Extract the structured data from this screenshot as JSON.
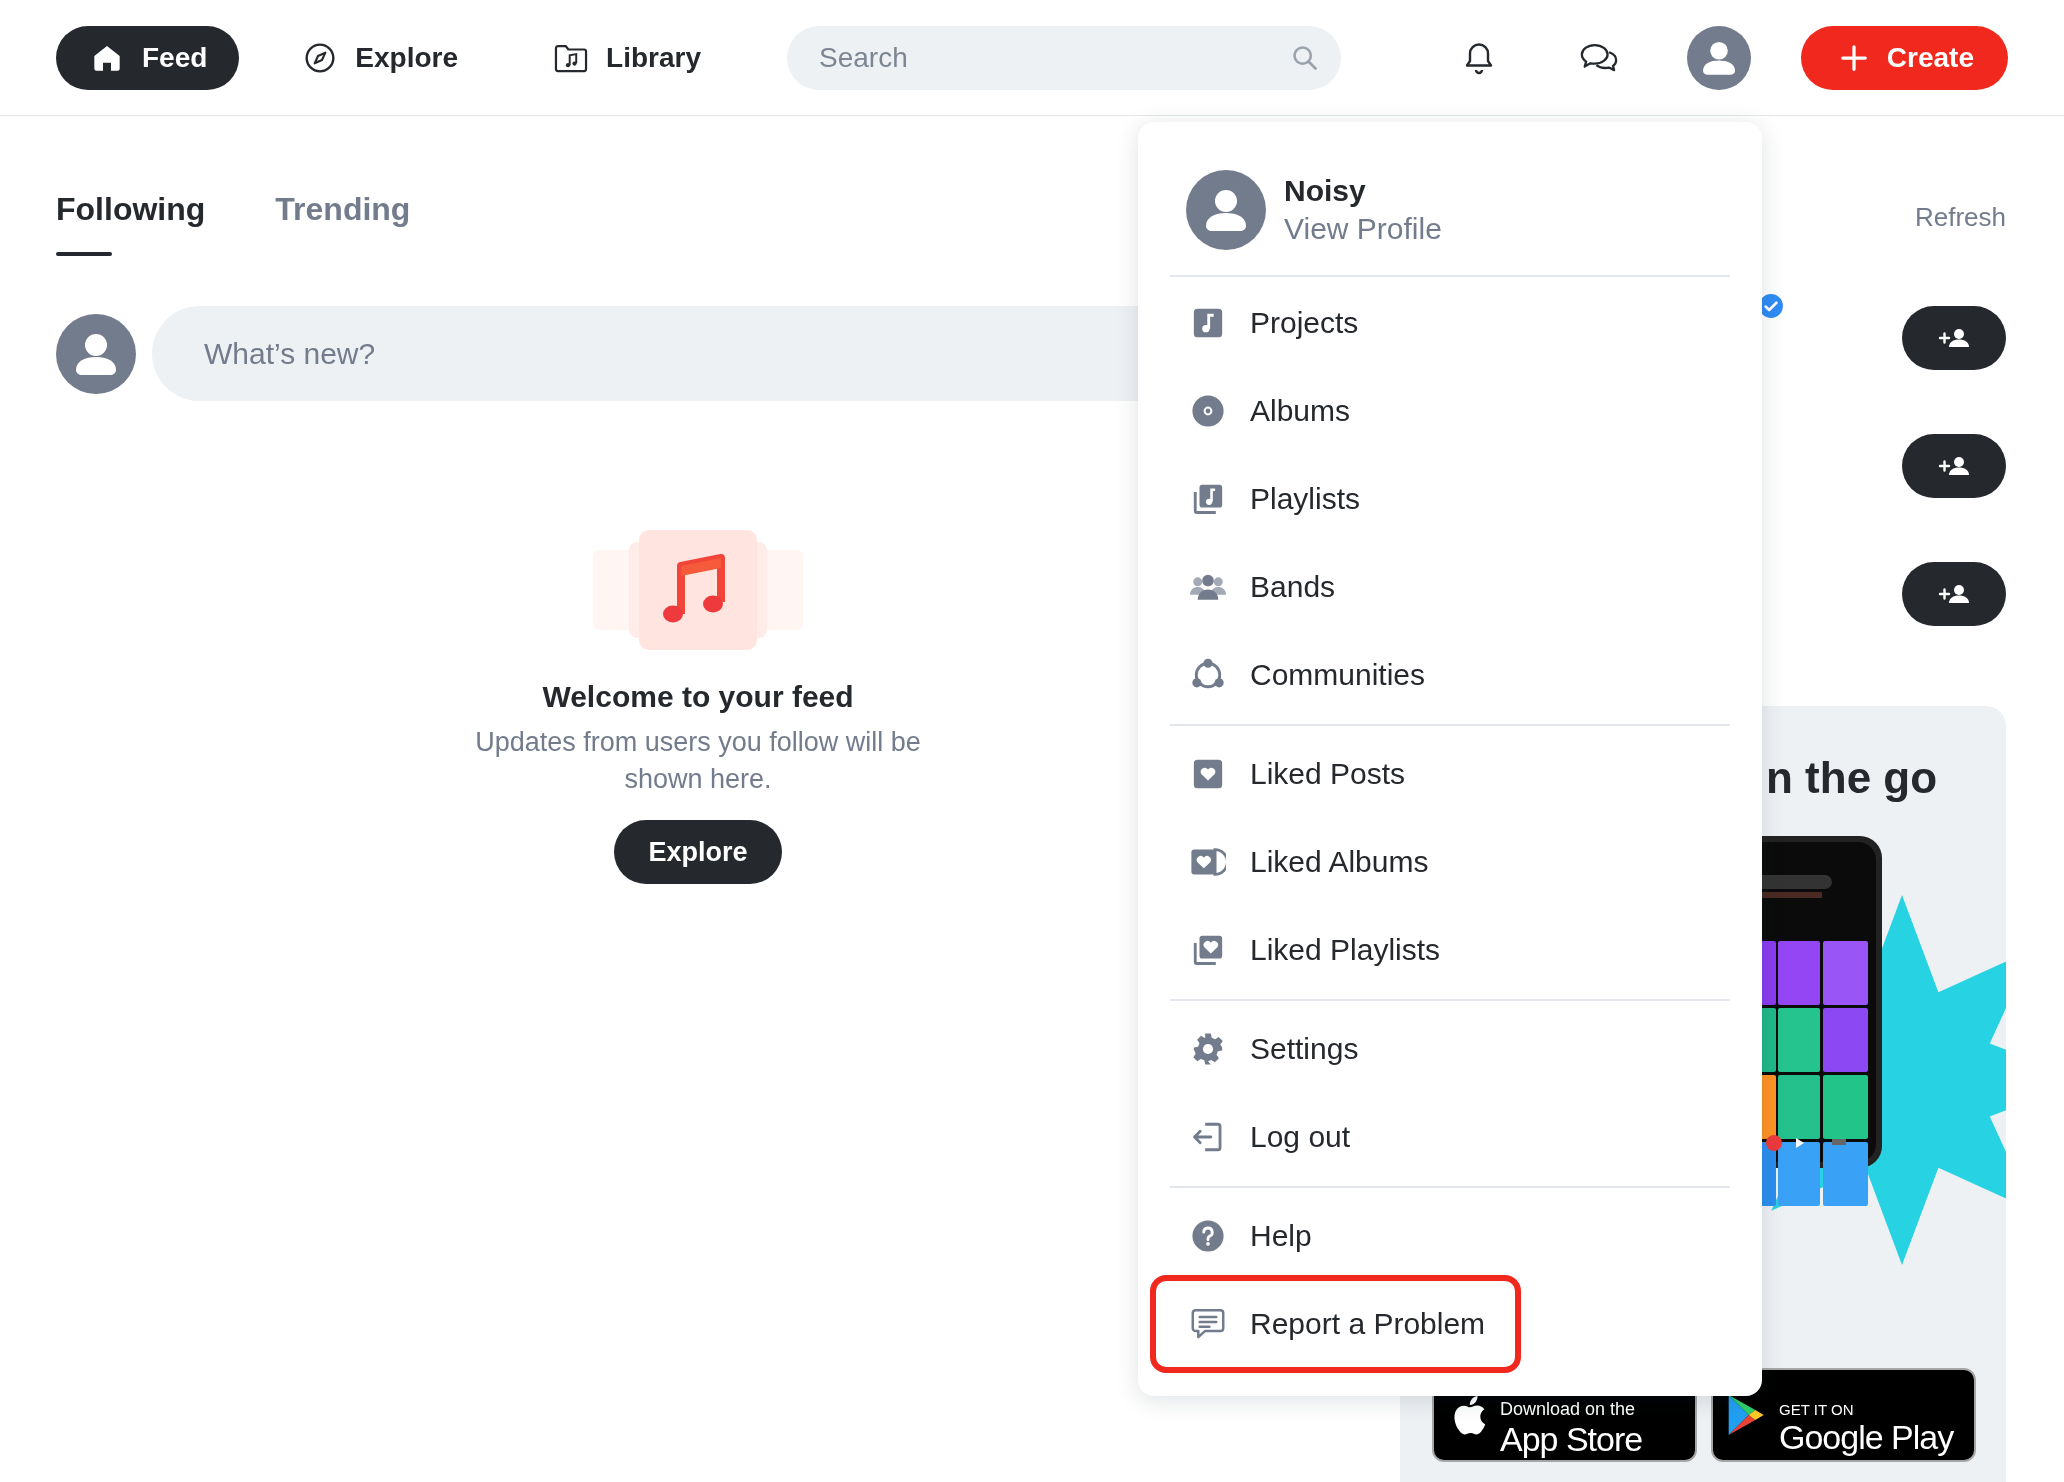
{
  "nav": [
    {
      "label": "Feed",
      "selected": true
    },
    {
      "label": "Explore",
      "selected": false
    },
    {
      "label": "Library",
      "selected": false
    }
  ],
  "search": {
    "placeholder": "Search"
  },
  "create_button": "Create",
  "tabs": [
    {
      "label": "Following",
      "selected": true
    },
    {
      "label": "Trending",
      "selected": false
    }
  ],
  "composer": {
    "placeholder": "What’s new?"
  },
  "empty_state": {
    "title": "Welcome to your feed",
    "message": "Updates from users you follow will be shown here.",
    "button": "Explore"
  },
  "refresh": "Refresh",
  "suggestions": [
    {
      "verified": true
    },
    {
      "verified": false
    },
    {
      "verified": false
    }
  ],
  "promo": {
    "heading": "n the go",
    "badges": [
      {
        "small": "Download on the",
        "big": "App Store"
      },
      {
        "small": "GET IT ON",
        "big": "Google Play"
      }
    ]
  },
  "profile_menu": {
    "name": "Noisy",
    "link": "View Profile",
    "groups": [
      [
        {
          "label": "Projects",
          "highlighted": false
        },
        {
          "label": "Albums",
          "highlighted": false
        },
        {
          "label": "Playlists",
          "highlighted": false
        },
        {
          "label": "Bands",
          "highlighted": false
        },
        {
          "label": "Communities",
          "highlighted": false
        }
      ],
      [
        {
          "label": "Liked Posts",
          "highlighted": false
        },
        {
          "label": "Liked Albums",
          "highlighted": false
        },
        {
          "label": "Liked Playlists",
          "highlighted": false
        }
      ],
      [
        {
          "label": "Settings",
          "highlighted": false
        },
        {
          "label": "Log out",
          "highlighted": false
        }
      ],
      [
        {
          "label": "Help",
          "highlighted": false
        },
        {
          "label": "Report a Problem",
          "highlighted": true
        }
      ]
    ]
  }
}
